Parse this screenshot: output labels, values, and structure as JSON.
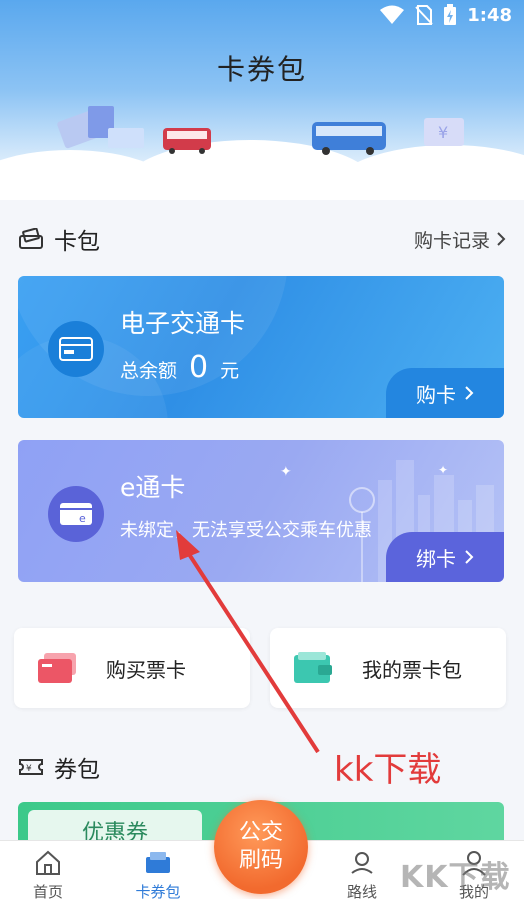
{
  "status_bar": {
    "time": "1:48",
    "wifi_icon": "wifi-icon",
    "sim_icon": "no-sim-icon",
    "battery_icon": "battery-charging-icon"
  },
  "header": {
    "title": "卡券包"
  },
  "card_pack": {
    "section_label": "卡包",
    "record_link": "购卡记录",
    "cards": [
      {
        "name": "电子交通卡",
        "balance_label": "总余额",
        "balance_value": "0",
        "balance_unit": "元",
        "action_label": "购卡"
      },
      {
        "name": "e通卡",
        "status_text": "未绑定，无法享受公交乘车优惠",
        "action_label": "绑卡"
      }
    ]
  },
  "quick_actions": [
    {
      "label": "购买票卡",
      "icon": "ticket-card-icon"
    },
    {
      "label": "我的票卡包",
      "icon": "wallet-icon"
    }
  ],
  "coupon_pack": {
    "section_label": "券包",
    "tag_label": "优惠券"
  },
  "fab": {
    "line1": "公交",
    "line2": "刷码"
  },
  "tabs": [
    {
      "label": "首页",
      "icon": "home-icon"
    },
    {
      "label": "卡券包",
      "icon": "card-wallet-icon",
      "active": true
    },
    {
      "label": "路线",
      "icon": "route-icon"
    },
    {
      "label": "我的",
      "icon": "user-icon"
    }
  ],
  "annotation": {
    "text": "kk下载",
    "watermark": "KK下载"
  },
  "colors": {
    "accent": "#2f7bd8",
    "card_blue": "#3aa0f2",
    "card_purple": "#8fa1f5",
    "fab": "#f26a2e",
    "annotation": "#e23b3b"
  }
}
